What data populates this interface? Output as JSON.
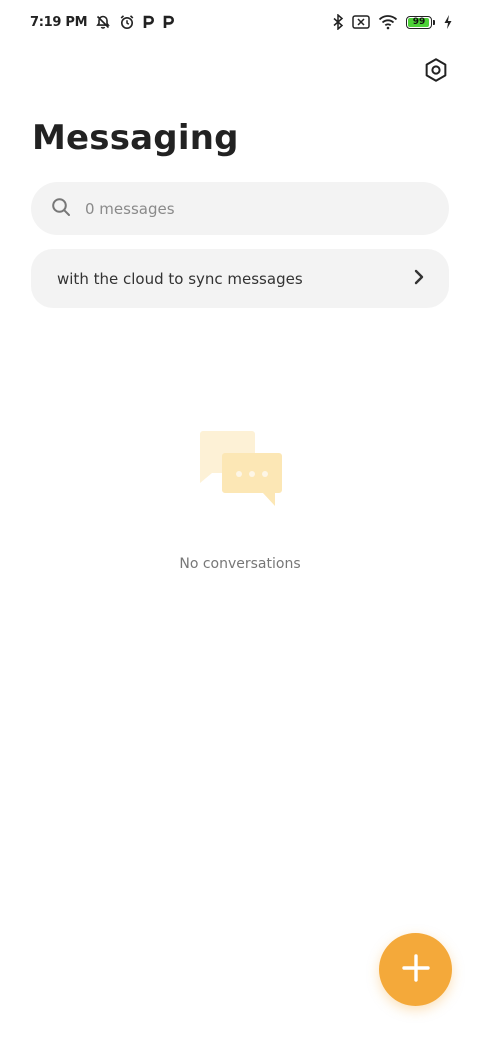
{
  "status_bar": {
    "time": "7:19 PM",
    "battery_level": "99",
    "battery_fraction": 0.99,
    "battery_color": "#4cd137",
    "icons_left": [
      "notifications-off-icon",
      "alarm-icon",
      "p-app-icon",
      "p-app-icon"
    ],
    "icons_right": [
      "bluetooth-icon",
      "no-sim-icon",
      "wifi-icon",
      "battery-icon",
      "charging-icon"
    ]
  },
  "header": {
    "title": "Messaging",
    "settings_icon": "gear-icon"
  },
  "search": {
    "placeholder": "0 messages",
    "value": ""
  },
  "sync_banner": {
    "text": "with the cloud to sync messages",
    "chevron_icon": "chevron-right-icon"
  },
  "empty_state": {
    "text": "No conversations",
    "illustration_color": "#fce7b5"
  },
  "fab": {
    "icon": "plus-icon",
    "color": "#f4a93a"
  }
}
